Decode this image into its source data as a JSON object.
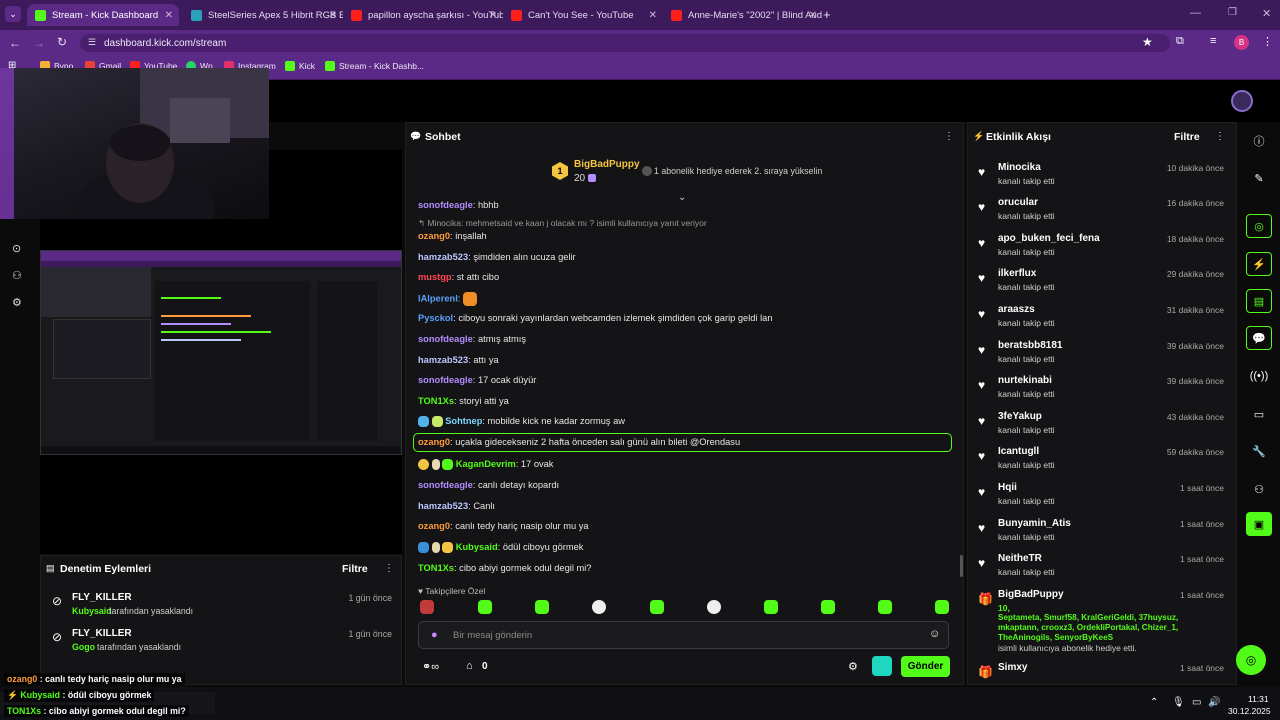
{
  "browser": {
    "tabs": [
      {
        "title": "Stream - Kick Dashboard",
        "color": "#53fc18",
        "active": true
      },
      {
        "title": "SteelSeries Apex 5 Hibrit RGB E",
        "color": "#2aa1b8"
      },
      {
        "title": "papillon ayscha şarkısı - YouTub",
        "color": "#ff1e1e"
      },
      {
        "title": "Can't You See - YouTube",
        "color": "#ff1e1e"
      },
      {
        "title": "Anne-Marie's \"2002\" | Blind Aud",
        "color": "#ff1e1e"
      }
    ],
    "url": "dashboard.kick.com/stream",
    "profile_initial": "B",
    "bookmarks": [
      "Bypo",
      "Gmail",
      "YouTube",
      "Wp",
      "Instagram",
      "Kick",
      "Stream - Kick Dashb..."
    ]
  },
  "chat": {
    "title": "Sohbet",
    "pinned": {
      "user": "BigBadPuppy",
      "count": "20",
      "rank": "1",
      "text": "1 abonelik hediye ederek 2. sıraya yükselin"
    },
    "reply_hint": "Minocika: mehmetsaid ve kaan j olacak mı ? isimli kullanıcıya yanıt veriyor",
    "messages": [
      {
        "user": "sonofdeagle",
        "color": "#b38cff",
        "text": "hbhb"
      },
      {
        "user": "ozang0",
        "color": "#ff9a3c",
        "text": "inşallah"
      },
      {
        "user": "hamzab523",
        "color": "#b9c7ff",
        "text": "şimdiden alın ucuza gelir"
      },
      {
        "user": "mustgp",
        "color": "#ff4757",
        "text": "st attı cibo"
      },
      {
        "user": "lAlperenl",
        "color": "#5aa0ff",
        "text": ""
      },
      {
        "user": "Pysckol",
        "color": "#5aa0ff",
        "text": "ciboyu sonraki yayınlardan webcamden izlemek şimdiden çok garip geldi lan"
      },
      {
        "user": "sonofdeagle",
        "color": "#b38cff",
        "text": "atmış atmış"
      },
      {
        "user": "hamzab523",
        "color": "#b9c7ff",
        "text": "attı ya"
      },
      {
        "user": "sonofdeagle",
        "color": "#b38cff",
        "text": "17 ocak düyür"
      },
      {
        "user": "TON1Xs",
        "color": "#53fc18",
        "text": "storyi atti ya"
      },
      {
        "user": "Sohtnep",
        "color": "#7fd6ff",
        "text": "mobilde kick ne kadar zormuş aw"
      },
      {
        "user": "ozang0",
        "color": "#ff9a3c",
        "text": "uçakla gidecekseniz 2 hafta önceden salı günü alın bileti @Orendasu"
      },
      {
        "user": "KaganDevrim",
        "color": "#53fc18",
        "text": "17 ovak"
      },
      {
        "user": "sonofdeagle",
        "color": "#b38cff",
        "text": "canlı detayı kopardı"
      },
      {
        "user": "hamzab523",
        "color": "#b9c7ff",
        "text": "Canlı"
      },
      {
        "user": "ozang0",
        "color": "#ff9a3c",
        "text": "canlı tedy hariç nasip olur mu ya"
      },
      {
        "user": "Kubysaid",
        "color": "#53fc18",
        "text": "ödül ciboyu görmek"
      },
      {
        "user": "TON1Xs",
        "color": "#53fc18",
        "text": "cibo abiyi gormek odul degil mi?"
      }
    ],
    "followers_only": "Takipçilere Özel",
    "input_placeholder": "Bir mesaj gönderin",
    "points_count": "0",
    "send_label": "Gönder"
  },
  "events": {
    "title": "Etkinlik Akışı",
    "filter": "Filtre",
    "items": [
      {
        "name": "Minocika",
        "desc": "kanalı takip etti",
        "time": "10 dakika önce"
      },
      {
        "name": "orucular",
        "desc": "kanalı takip etti",
        "time": "16 dakika önce"
      },
      {
        "name": "apo_buken_feci_fena",
        "desc": "kanalı takip etti",
        "time": "18 dakika önce"
      },
      {
        "name": "ilkerflux",
        "desc": "kanalı takip etti",
        "time": "29 dakika önce"
      },
      {
        "name": "araaszs",
        "desc": "kanalı takip etti",
        "time": "31 dakika önce"
      },
      {
        "name": "beratsbb8181",
        "desc": "kanalı takip etti",
        "time": "39 dakika önce"
      },
      {
        "name": "nurtekinabi",
        "desc": "kanalı takip etti",
        "time": "39 dakika önce"
      },
      {
        "name": "3feYakup",
        "desc": "kanalı takip etti",
        "time": "43 dakika önce"
      },
      {
        "name": "Icantugll",
        "desc": "kanalı takip etti",
        "time": "59 dakika önce"
      },
      {
        "name": "Hqii",
        "desc": "kanalı takip etti",
        "time": "1 saat önce"
      },
      {
        "name": "Bunyamin_Atis",
        "desc": "kanalı takip etti",
        "time": "1 saat önce"
      },
      {
        "name": "NeitheTR",
        "desc": "kanalı takip etti",
        "time": "1 saat önce"
      }
    ],
    "gift": {
      "name": "BigBadPuppy",
      "time": "1 saat önce",
      "count": "10,",
      "recipients": "Septameta, Smurf58, KralGeriGeldi, 37huysuz, mkaptann, crooxz3, OrdekliPortakal, Chizer_1, TheAninogils, SenyorByKeeS",
      "desc": "isimli kullanıcıya abonelik hediye etti."
    },
    "last": {
      "name": "Simxy",
      "time": "1 saat önce"
    }
  },
  "modlog": {
    "title": "Denetim Eylemleri",
    "filter": "Filtre",
    "items": [
      {
        "user": "FLY_KILLER",
        "by": "Kubysaid",
        "action": "tarafından yasaklandı",
        "time": "1 gün önce"
      },
      {
        "user": "FLY_KILLER",
        "by": "Gogo",
        "action": "tarafından yasaklandı",
        "time": "1 gün önce"
      }
    ]
  },
  "overlay": [
    {
      "user": "ozang0",
      "color": "#ff9a3c",
      "text": "canlı tedy hariç nasip olur mu ya"
    },
    {
      "user": "Kubysaid",
      "color": "#53fc18",
      "text": "ödül ciboyu görmek"
    },
    {
      "user": "TON1Xs",
      "color": "#53fc18",
      "text": "cibo abiyi gormek odul degil mi?"
    }
  ],
  "taskbar": {
    "time": "11:31",
    "date": "30.12.2025"
  }
}
